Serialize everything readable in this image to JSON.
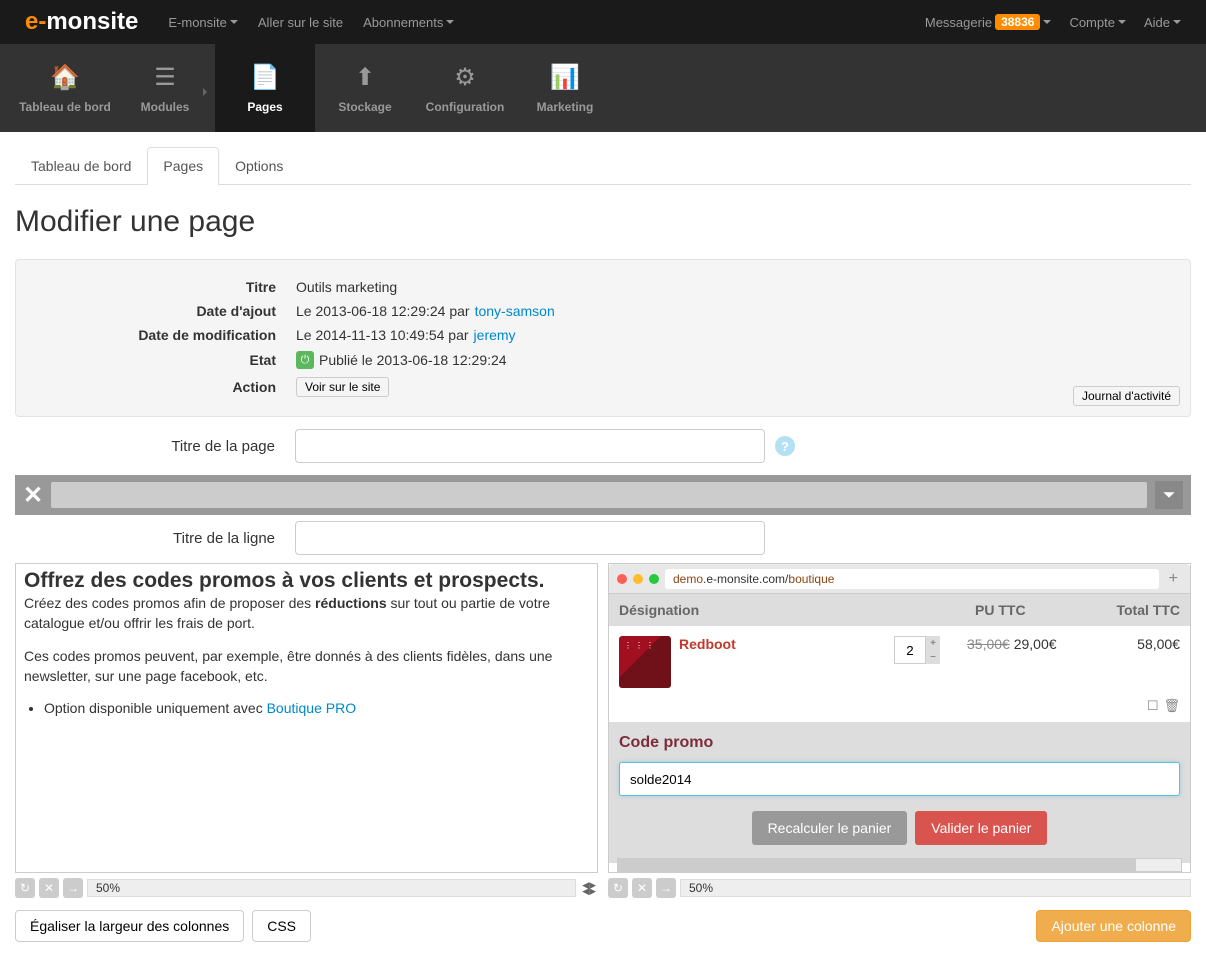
{
  "logo": {
    "prefix": "e-",
    "main": "monsite"
  },
  "topnav": {
    "left": [
      "E-monsite",
      "Aller sur le site",
      "Abonnements"
    ],
    "messagerie_label": "Messagerie",
    "messagerie_count": "38836",
    "compte": "Compte",
    "aide": "Aide"
  },
  "mainnav": [
    "Tableau de bord",
    "Modules",
    "Pages",
    "Stockage",
    "Configuration",
    "Marketing"
  ],
  "tabs": [
    "Tableau de bord",
    "Pages",
    "Options"
  ],
  "page_title": "Modifier une page",
  "info": {
    "titre_label": "Titre",
    "titre_value": "Outils marketing",
    "ajout_label": "Date d'ajout",
    "ajout_prefix": "Le 2013-06-18 12:29:24 par ",
    "ajout_author": "tony-samson",
    "modif_label": "Date de modification",
    "modif_prefix": "Le 2014-11-13 10:49:54 par ",
    "modif_author": "jeremy",
    "etat_label": "Etat",
    "etat_value": "Publié le 2013-06-18 12:29:24",
    "action_label": "Action",
    "action_btn": "Voir sur le site",
    "journal_btn": "Journal d'activité"
  },
  "form": {
    "titre_page_label": "Titre de la page",
    "titre_ligne_label": "Titre de la ligne"
  },
  "editor_left": {
    "heading": "Offrez des codes promos à vos clients et prospects.",
    "p1_pre": "Créez des codes promos afin de proposer des ",
    "p1_bold": "réductions",
    "p1_post": " sur tout ou partie de votre catalogue et/ou offrir les frais de port.",
    "p2": "Ces codes promos peuvent, par exemple, être donnés à des clients fidèles, dans une newsletter, sur une page facebook, etc.",
    "li_pre": "Option disponible uniquement avec ",
    "li_link": "Boutique PRO"
  },
  "browser": {
    "url_pre": "demo",
    "url_mid": ".e-monsite.com/",
    "url_post": "boutique",
    "headers": {
      "designation": "Désignation",
      "pu": "PU TTC",
      "total": "Total TTC"
    },
    "product": {
      "name": "Redboot",
      "qty": "2",
      "old_price": "35,00€",
      "price": "29,00€",
      "total": "58,00€"
    },
    "promo_label": "Code promo",
    "promo_value": "solde2014",
    "btn_recalc": "Recalculer le panier",
    "btn_valid": "Valider le panier"
  },
  "col_pct": "50%",
  "bottom": {
    "egaliser": "Égaliser la largeur des colonnes",
    "css": "CSS",
    "ajouter": "Ajouter une colonne"
  }
}
